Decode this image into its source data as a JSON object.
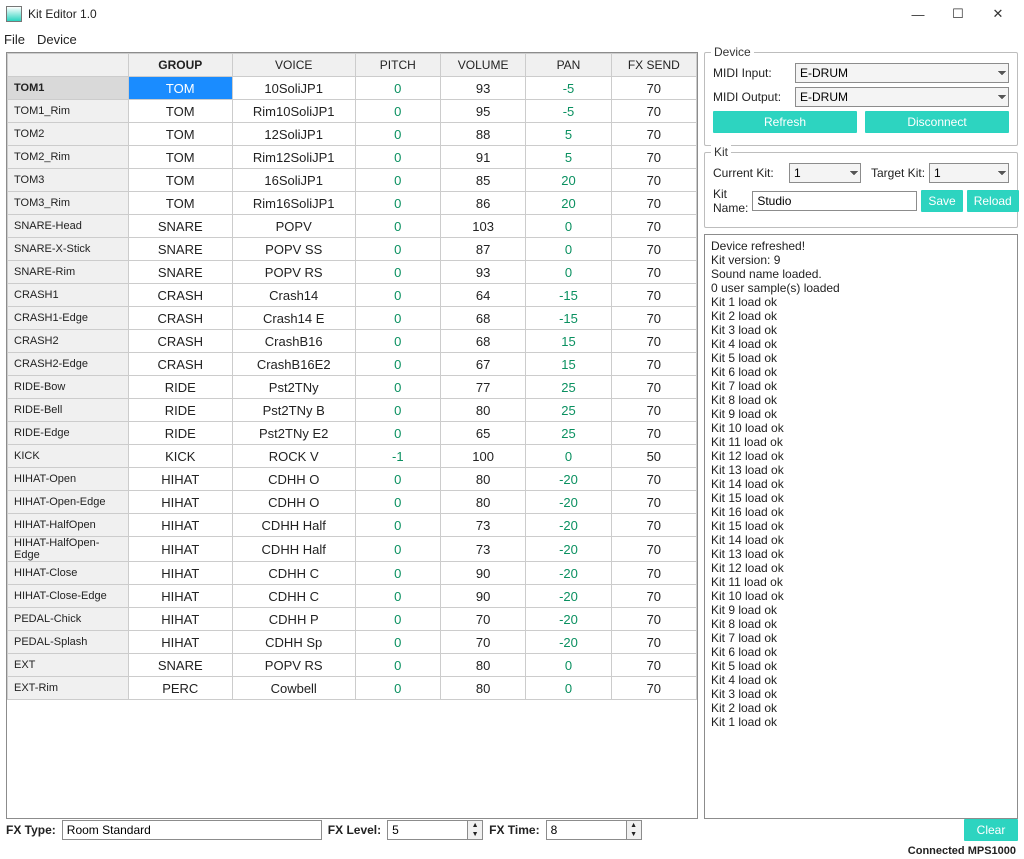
{
  "app_title": "Kit Editor 1.0",
  "menu": {
    "file": "File",
    "device": "Device"
  },
  "winctrl": {
    "min": "—",
    "max": "☐",
    "close": "✕"
  },
  "columns": {
    "row": "",
    "group": "GROUP",
    "voice": "VOICE",
    "pitch": "PITCH",
    "volume": "VOLUME",
    "pan": "PAN",
    "fx": "FX SEND"
  },
  "rows": [
    {
      "name": "TOM1",
      "group": "TOM",
      "voice": "10SoliJP1",
      "pitch": "0",
      "volume": "93",
      "pan": "-5",
      "fx": "70",
      "selected": true
    },
    {
      "name": "TOM1_Rim",
      "group": "TOM",
      "voice": "Rim10SoliJP1",
      "pitch": "0",
      "volume": "95",
      "pan": "-5",
      "fx": "70"
    },
    {
      "name": "TOM2",
      "group": "TOM",
      "voice": "12SoliJP1",
      "pitch": "0",
      "volume": "88",
      "pan": "5",
      "fx": "70"
    },
    {
      "name": "TOM2_Rim",
      "group": "TOM",
      "voice": "Rim12SoliJP1",
      "pitch": "0",
      "volume": "91",
      "pan": "5",
      "fx": "70"
    },
    {
      "name": "TOM3",
      "group": "TOM",
      "voice": "16SoliJP1",
      "pitch": "0",
      "volume": "85",
      "pan": "20",
      "fx": "70"
    },
    {
      "name": "TOM3_Rim",
      "group": "TOM",
      "voice": "Rim16SoliJP1",
      "pitch": "0",
      "volume": "86",
      "pan": "20",
      "fx": "70"
    },
    {
      "name": "SNARE-Head",
      "group": "SNARE",
      "voice": "POPV",
      "pitch": "0",
      "volume": "103",
      "pan": "0",
      "fx": "70"
    },
    {
      "name": "SNARE-X-Stick",
      "group": "SNARE",
      "voice": "POPV SS",
      "pitch": "0",
      "volume": "87",
      "pan": "0",
      "fx": "70"
    },
    {
      "name": "SNARE-Rim",
      "group": "SNARE",
      "voice": "POPV RS",
      "pitch": "0",
      "volume": "93",
      "pan": "0",
      "fx": "70"
    },
    {
      "name": "CRASH1",
      "group": "CRASH",
      "voice": "Crash14",
      "pitch": "0",
      "volume": "64",
      "pan": "-15",
      "fx": "70"
    },
    {
      "name": "CRASH1-Edge",
      "group": "CRASH",
      "voice": "Crash14 E",
      "pitch": "0",
      "volume": "68",
      "pan": "-15",
      "fx": "70"
    },
    {
      "name": "CRASH2",
      "group": "CRASH",
      "voice": "CrashB16",
      "pitch": "0",
      "volume": "68",
      "pan": "15",
      "fx": "70"
    },
    {
      "name": "CRASH2-Edge",
      "group": "CRASH",
      "voice": "CrashB16E2",
      "pitch": "0",
      "volume": "67",
      "pan": "15",
      "fx": "70"
    },
    {
      "name": "RIDE-Bow",
      "group": "RIDE",
      "voice": "Pst2TNy",
      "pitch": "0",
      "volume": "77",
      "pan": "25",
      "fx": "70"
    },
    {
      "name": "RIDE-Bell",
      "group": "RIDE",
      "voice": "Pst2TNy B",
      "pitch": "0",
      "volume": "80",
      "pan": "25",
      "fx": "70"
    },
    {
      "name": "RIDE-Edge",
      "group": "RIDE",
      "voice": "Pst2TNy E2",
      "pitch": "0",
      "volume": "65",
      "pan": "25",
      "fx": "70"
    },
    {
      "name": "KICK",
      "group": "KICK",
      "voice": "ROCK V",
      "pitch": "-1",
      "volume": "100",
      "pan": "0",
      "fx": "50"
    },
    {
      "name": "HIHAT-Open",
      "group": "HIHAT",
      "voice": "CDHH O",
      "pitch": "0",
      "volume": "80",
      "pan": "-20",
      "fx": "70"
    },
    {
      "name": "HIHAT-Open-Edge",
      "group": "HIHAT",
      "voice": "CDHH O",
      "pitch": "0",
      "volume": "80",
      "pan": "-20",
      "fx": "70"
    },
    {
      "name": "HIHAT-HalfOpen",
      "group": "HIHAT",
      "voice": "CDHH Half",
      "pitch": "0",
      "volume": "73",
      "pan": "-20",
      "fx": "70"
    },
    {
      "name": "HIHAT-HalfOpen-Edge",
      "group": "HIHAT",
      "voice": "CDHH Half",
      "pitch": "0",
      "volume": "73",
      "pan": "-20",
      "fx": "70"
    },
    {
      "name": "HIHAT-Close",
      "group": "HIHAT",
      "voice": "CDHH C",
      "pitch": "0",
      "volume": "90",
      "pan": "-20",
      "fx": "70"
    },
    {
      "name": "HIHAT-Close-Edge",
      "group": "HIHAT",
      "voice": "CDHH C",
      "pitch": "0",
      "volume": "90",
      "pan": "-20",
      "fx": "70"
    },
    {
      "name": "PEDAL-Chick",
      "group": "HIHAT",
      "voice": "CDHH P",
      "pitch": "0",
      "volume": "70",
      "pan": "-20",
      "fx": "70"
    },
    {
      "name": "PEDAL-Splash",
      "group": "HIHAT",
      "voice": "CDHH Sp",
      "pitch": "0",
      "volume": "70",
      "pan": "-20",
      "fx": "70"
    },
    {
      "name": "EXT",
      "group": "SNARE",
      "voice": "POPV RS",
      "pitch": "0",
      "volume": "80",
      "pan": "0",
      "fx": "70"
    },
    {
      "name": "EXT-Rim",
      "group": "PERC",
      "voice": "Cowbell",
      "pitch": "0",
      "volume": "80",
      "pan": "0",
      "fx": "70"
    }
  ],
  "device": {
    "legend": "Device",
    "midi_in_label": "MIDI Input:",
    "midi_in": "E-DRUM",
    "midi_out_label": "MIDI Output:",
    "midi_out": "E-DRUM",
    "refresh": "Refresh",
    "disconnect": "Disconnect"
  },
  "kit": {
    "legend": "Kit",
    "current_label": "Current Kit:",
    "current": "1",
    "target_label": "Target Kit:",
    "target": "1",
    "name_label": "Kit Name:",
    "name": "Studio",
    "save": "Save",
    "reload": "Reload"
  },
  "log": "Device refreshed!\nKit version: 9\nSound name loaded.\n0 user sample(s) loaded\nKit 1 load ok\nKit 2 load ok\nKit 3 load ok\nKit 4 load ok\nKit 5 load ok\nKit 6 load ok\nKit 7 load ok\nKit 8 load ok\nKit 9 load ok\nKit 10 load ok\nKit 11 load ok\nKit 12 load ok\nKit 13 load ok\nKit 14 load ok\nKit 15 load ok\nKit 16 load ok\nKit 15 load ok\nKit 14 load ok\nKit 13 load ok\nKit 12 load ok\nKit 11 load ok\nKit 10 load ok\nKit 9 load ok\nKit 8 load ok\nKit 7 load ok\nKit 6 load ok\nKit 5 load ok\nKit 4 load ok\nKit 3 load ok\nKit 2 load ok\nKit 1 load ok",
  "fx": {
    "type_label": "FX Type:",
    "type": "Room Standard",
    "level_label": "FX Level:",
    "level": "5",
    "time_label": "FX Time:",
    "time": "8"
  },
  "clear": "Clear",
  "status": "Connected  MPS1000"
}
